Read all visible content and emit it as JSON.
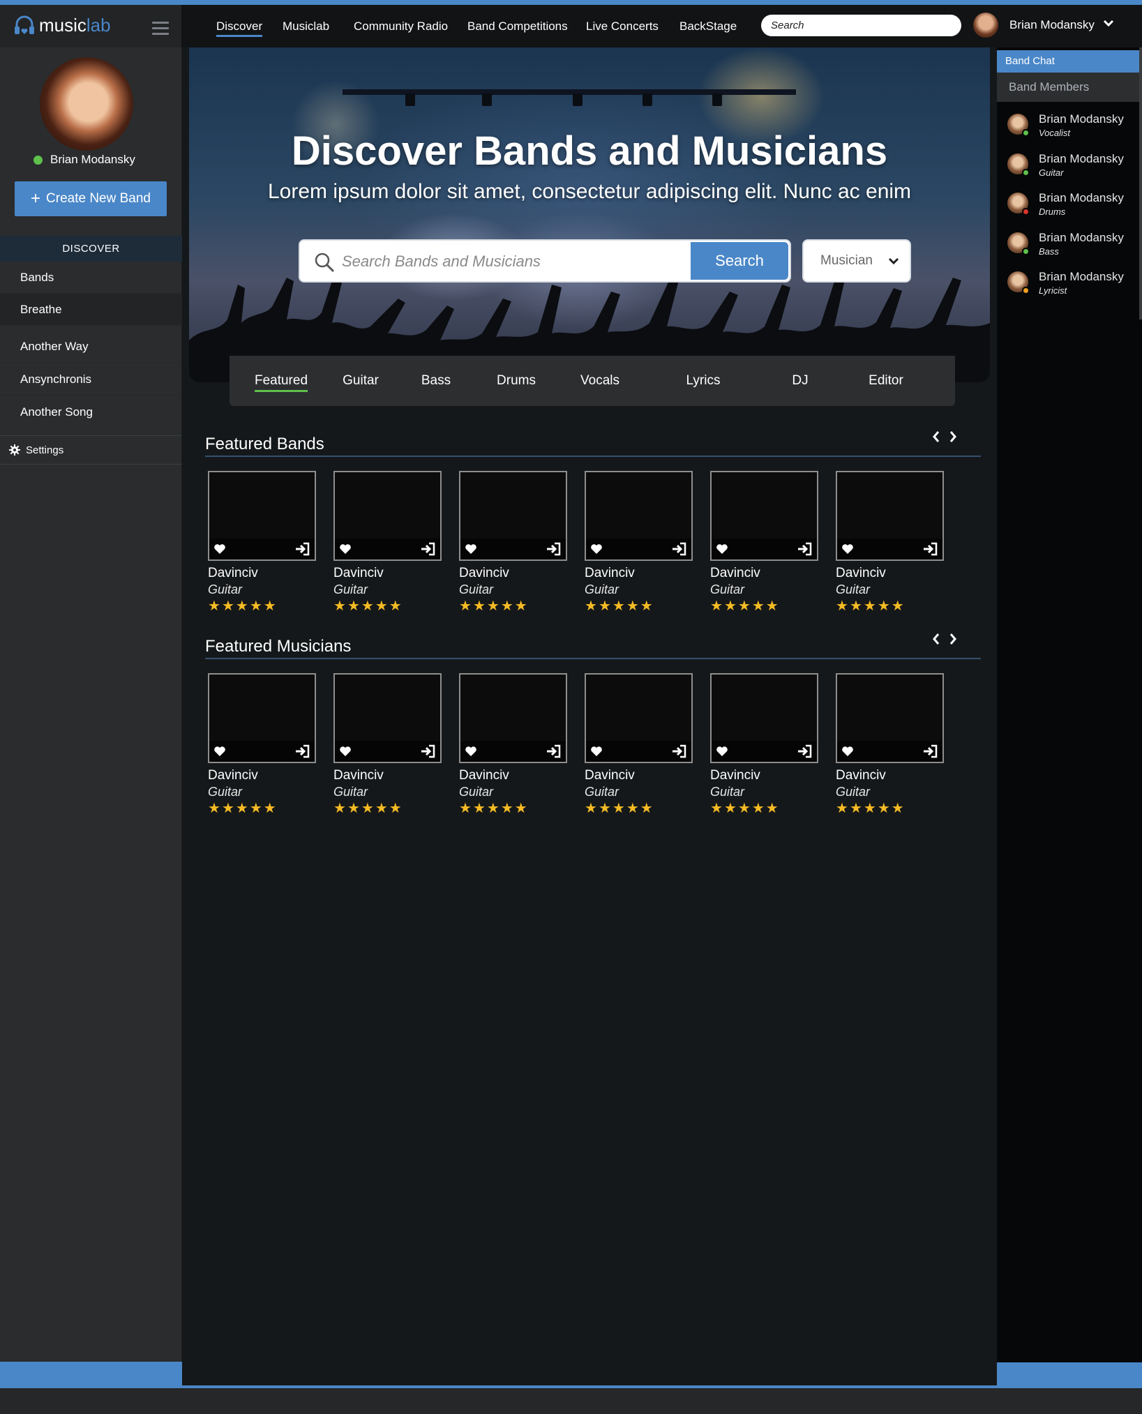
{
  "brand": {
    "name_part1": "music",
    "name_part2": "lab"
  },
  "nav": {
    "items": [
      "Discover",
      "Musiclab",
      "Community Radio",
      "Band Competitions",
      "Live Concerts",
      "BackStage"
    ],
    "search_placeholder": "Search"
  },
  "user": {
    "name": "Brian Modansky",
    "status_color": "#5fc04b"
  },
  "sidebar": {
    "create_label": "Create New Band",
    "section": "DISCOVER",
    "items": [
      "Bands",
      "Breathe",
      "Another Way",
      "Ansynchronis",
      "Another Song"
    ],
    "settings_label": "Settings"
  },
  "hero": {
    "title": "Discover Bands and Musicians",
    "subtitle": "Lorem ipsum dolor sit amet, consectetur adipiscing elit. Nunc ac enim",
    "search_placeholder": "Search Bands and Musicians",
    "search_button": "Search",
    "type_select": "Musician"
  },
  "tabs": [
    "Featured",
    "Guitar",
    "Bass",
    "Drums",
    "Vocals",
    "Lyrics",
    "DJ",
    "Editor"
  ],
  "sections": [
    {
      "title": "Featured Bands",
      "cards": [
        {
          "name": "Davinciv",
          "role": "Guitar",
          "rating": 5
        },
        {
          "name": "Davinciv",
          "role": "Guitar",
          "rating": 5
        },
        {
          "name": "Davinciv",
          "role": "Guitar",
          "rating": 5
        },
        {
          "name": "Davinciv",
          "role": "Guitar",
          "rating": 5
        },
        {
          "name": "Davinciv",
          "role": "Guitar",
          "rating": 5
        },
        {
          "name": "Davinciv",
          "role": "Guitar",
          "rating": 5
        }
      ]
    },
    {
      "title": "Featured Musicians",
      "cards": [
        {
          "name": "Davinciv",
          "role": "Guitar",
          "rating": 5
        },
        {
          "name": "Davinciv",
          "role": "Guitar",
          "rating": 5
        },
        {
          "name": "Davinciv",
          "role": "Guitar",
          "rating": 5
        },
        {
          "name": "Davinciv",
          "role": "Guitar",
          "rating": 5
        },
        {
          "name": "Davinciv",
          "role": "Guitar",
          "rating": 5
        },
        {
          "name": "Davinciv",
          "role": "Guitar",
          "rating": 5
        }
      ]
    }
  ],
  "right_panel": {
    "band_chat": "Band Chat",
    "members_title": "Band Members",
    "members": [
      {
        "name": "Brian Modansky",
        "role": "Vocalist",
        "status": "#5fc04b"
      },
      {
        "name": "Brian Modansky",
        "role": "Guitar",
        "status": "#5fc04b"
      },
      {
        "name": "Brian Modansky",
        "role": "Drums",
        "status": "#d9342b"
      },
      {
        "name": "Brian Modansky",
        "role": "Bass",
        "status": "#5fc04b"
      },
      {
        "name": "Brian Modansky",
        "role": "Lyricist",
        "status": "#f0a020"
      }
    ]
  },
  "colors": {
    "accent": "#4a87c8",
    "online": "#5fc04b",
    "star": "#f5bb24"
  }
}
